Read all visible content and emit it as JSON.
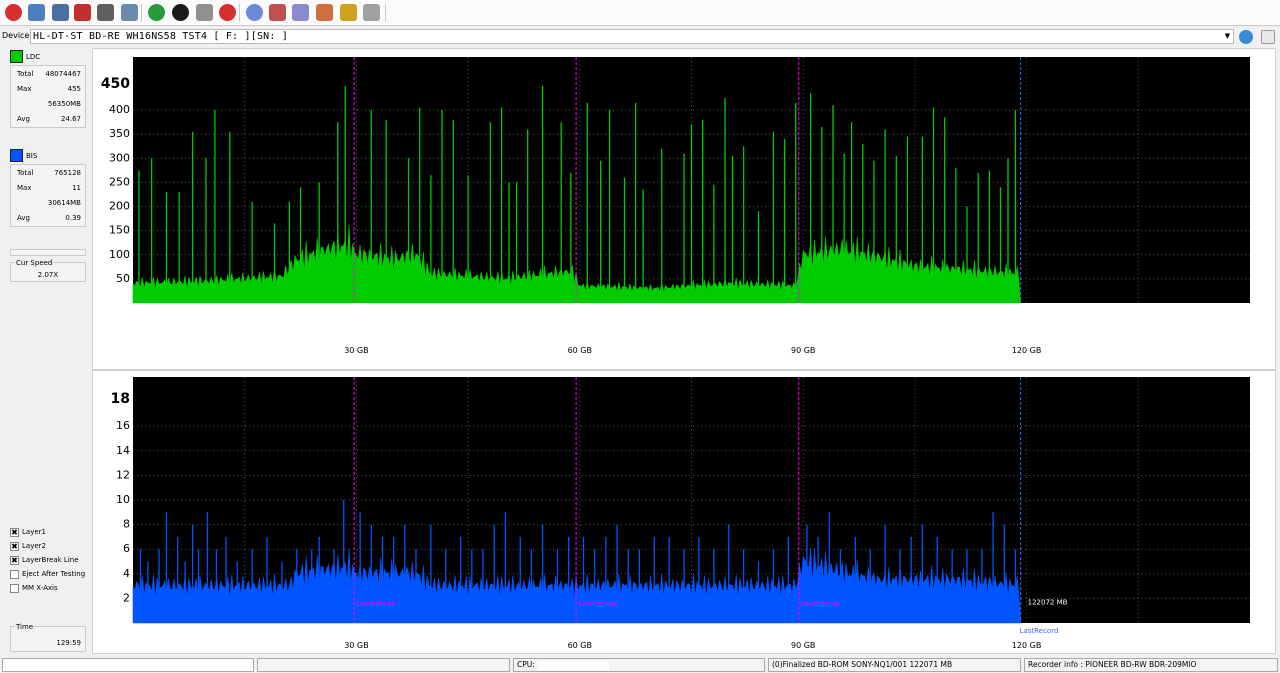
{
  "toolbar": {
    "icons": [
      "exit-icon",
      "settings-icon",
      "device-info-icon",
      "erase-icon",
      "disc-icon",
      "copy-icon",
      "refresh-icon",
      "start-icon",
      "quick-scan-icon",
      "stop-icon",
      "disc-quality-icon",
      "burn-icon",
      "save-icon",
      "screenshot-icon",
      "chart-icon",
      "clean-icon"
    ]
  },
  "device": {
    "label": "Device:",
    "value": "HL-DT-ST BD-RE  WH16NS58  TST4 [ F: ][SN:               ]"
  },
  "ldc": {
    "label": "LDC",
    "color": "#00cc00",
    "total_label": "Total",
    "total": "48074467",
    "max_label": "Max",
    "max": "455",
    "size": "56350MB",
    "avg_label": "Avg",
    "avg": "24.67"
  },
  "bis": {
    "label": "BIS",
    "color": "#0055ff",
    "total_label": "Total",
    "total": "765128",
    "max_label": "Max",
    "max": "11",
    "size": "30614MB",
    "avg_label": "Avg",
    "avg": "0.39"
  },
  "speed": {
    "label": "Cur Speed",
    "value": "2.07X"
  },
  "options": [
    {
      "label": "Layer1",
      "checked": true
    },
    {
      "label": "Layer2",
      "checked": true
    },
    {
      "label": "LayerBreak Line",
      "checked": true
    },
    {
      "label": "Eject After Testing",
      "checked": false
    },
    {
      "label": "MM X-Axis",
      "checked": false
    }
  ],
  "time": {
    "label": "Time",
    "value": "129:59"
  },
  "chart_data": [
    {
      "type": "area",
      "series": [
        {
          "name": "LDC",
          "color": "#00cc00"
        }
      ],
      "x_unit": "GB",
      "xlim": [
        0,
        150
      ],
      "ylim": [
        0,
        510
      ],
      "ymax_label": "450",
      "yticks": [
        50,
        100,
        150,
        200,
        250,
        300,
        350,
        400
      ],
      "xticks": [
        "30 GB",
        "60 GB",
        "90 GB",
        "120 GB"
      ],
      "xtick_values": [
        30,
        60,
        90,
        120
      ],
      "layer_breaks": [
        29.7,
        59.5,
        89.4
      ],
      "last_record": 119.2,
      "baseline_profile": [
        [
          0,
          40
        ],
        [
          10,
          45
        ],
        [
          20,
          55
        ],
        [
          22,
          90
        ],
        [
          26,
          110
        ],
        [
          29,
          120
        ],
        [
          30,
          100
        ],
        [
          35,
          90
        ],
        [
          38,
          100
        ],
        [
          40,
          60
        ],
        [
          50,
          50
        ],
        [
          59,
          65
        ],
        [
          60,
          35
        ],
        [
          70,
          30
        ],
        [
          80,
          40
        ],
        [
          89,
          35
        ],
        [
          90,
          100
        ],
        [
          95,
          110
        ],
        [
          100,
          95
        ],
        [
          105,
          75
        ],
        [
          110,
          70
        ],
        [
          119,
          60
        ]
      ],
      "spikes": [
        [
          0.8,
          275
        ],
        [
          2.5,
          300
        ],
        [
          4.5,
          230
        ],
        [
          6.2,
          230
        ],
        [
          8,
          355
        ],
        [
          9.8,
          300
        ],
        [
          11,
          400
        ],
        [
          13,
          355
        ],
        [
          16,
          210
        ],
        [
          19,
          165
        ],
        [
          21,
          210
        ],
        [
          22.5,
          240
        ],
        [
          25,
          250
        ],
        [
          27.5,
          375
        ],
        [
          28.5,
          450
        ],
        [
          32,
          400
        ],
        [
          34,
          380
        ],
        [
          37,
          300
        ],
        [
          38.5,
          405
        ],
        [
          40,
          265
        ],
        [
          41.5,
          400
        ],
        [
          43,
          380
        ],
        [
          45,
          265
        ],
        [
          48,
          375
        ],
        [
          49.5,
          405
        ],
        [
          50.5,
          250
        ],
        [
          51.5,
          250
        ],
        [
          53,
          360
        ],
        [
          55,
          450
        ],
        [
          57.5,
          375
        ],
        [
          58.8,
          270
        ],
        [
          61,
          415
        ],
        [
          62.8,
          295
        ],
        [
          64,
          400
        ],
        [
          66,
          260
        ],
        [
          67.5,
          415
        ],
        [
          68.5,
          235
        ],
        [
          71,
          320
        ],
        [
          74,
          310
        ],
        [
          75,
          370
        ],
        [
          76.5,
          380
        ],
        [
          78,
          245
        ],
        [
          79.5,
          425
        ],
        [
          80.5,
          305
        ],
        [
          82,
          325
        ],
        [
          84,
          190
        ],
        [
          86,
          355
        ],
        [
          87.5,
          340
        ],
        [
          89,
          415
        ],
        [
          91,
          435
        ],
        [
          92.5,
          365
        ],
        [
          94,
          410
        ],
        [
          95.5,
          310
        ],
        [
          96.5,
          375
        ],
        [
          98,
          330
        ],
        [
          99.5,
          295
        ],
        [
          101,
          360
        ],
        [
          102.5,
          305
        ],
        [
          104,
          345
        ],
        [
          106,
          345
        ],
        [
          107.5,
          405
        ],
        [
          109,
          385
        ],
        [
          110.5,
          280
        ],
        [
          112,
          200
        ],
        [
          113.5,
          270
        ],
        [
          115,
          275
        ],
        [
          116.5,
          240
        ],
        [
          117.5,
          300
        ],
        [
          118.5,
          400
        ]
      ]
    },
    {
      "type": "bar",
      "series": [
        {
          "name": "BIS",
          "color": "#0055ff"
        }
      ],
      "x_unit": "GB",
      "xlim": [
        0,
        150
      ],
      "ylim": [
        0,
        20
      ],
      "ymax_label": "18",
      "yticks": [
        2,
        4,
        6,
        8,
        10,
        12,
        14,
        16
      ],
      "xticks": [
        "30 GB",
        "60 GB",
        "90 GB",
        "120 GB"
      ],
      "xtick_values": [
        30,
        60,
        90,
        120
      ],
      "layer_breaks": [
        29.7,
        59.5,
        89.4
      ],
      "layer_break_label": "LayerBreak",
      "last_record": 119.2,
      "last_record_label": "LastRecord",
      "last_record_value": "122072 MB",
      "baseline_profile": [
        [
          0,
          3
        ],
        [
          21,
          3
        ],
        [
          22,
          4
        ],
        [
          29,
          4.5
        ],
        [
          30,
          4
        ],
        [
          38,
          4
        ],
        [
          40,
          3
        ],
        [
          60,
          3
        ],
        [
          89,
          3
        ],
        [
          90,
          5
        ],
        [
          96,
          4
        ],
        [
          100,
          3.5
        ],
        [
          110,
          3.5
        ],
        [
          119,
          3
        ]
      ],
      "spikes": [
        [
          1,
          6
        ],
        [
          2,
          5
        ],
        [
          3.5,
          6
        ],
        [
          4.5,
          9
        ],
        [
          6,
          7
        ],
        [
          7,
          5
        ],
        [
          8,
          8
        ],
        [
          8.8,
          6
        ],
        [
          10,
          9
        ],
        [
          11.2,
          6
        ],
        [
          12.5,
          7
        ],
        [
          14,
          5
        ],
        [
          16,
          6
        ],
        [
          18,
          7
        ],
        [
          20,
          5
        ],
        [
          22,
          6
        ],
        [
          24,
          6
        ],
        [
          25,
          7
        ],
        [
          27,
          6
        ],
        [
          28.3,
          10
        ],
        [
          30.5,
          9
        ],
        [
          32,
          8
        ],
        [
          33.5,
          7
        ],
        [
          35,
          7
        ],
        [
          36.5,
          8
        ],
        [
          38,
          6
        ],
        [
          40,
          8
        ],
        [
          42,
          6
        ],
        [
          44,
          7
        ],
        [
          45.5,
          6
        ],
        [
          47,
          6
        ],
        [
          48.5,
          8
        ],
        [
          50,
          9
        ],
        [
          52,
          7
        ],
        [
          53.5,
          6
        ],
        [
          55,
          8
        ],
        [
          57,
          6
        ],
        [
          58.5,
          7
        ],
        [
          60.5,
          7
        ],
        [
          62,
          6
        ],
        [
          63.5,
          7
        ],
        [
          65,
          8
        ],
        [
          66.5,
          6
        ],
        [
          68,
          6
        ],
        [
          70,
          7
        ],
        [
          72,
          7
        ],
        [
          74,
          6
        ],
        [
          76,
          7
        ],
        [
          78,
          6
        ],
        [
          80,
          8
        ],
        [
          82,
          6
        ],
        [
          84,
          5
        ],
        [
          86,
          6
        ],
        [
          88,
          7
        ],
        [
          90.5,
          8
        ],
        [
          92,
          7
        ],
        [
          93.5,
          9
        ],
        [
          95,
          6
        ],
        [
          97,
          7
        ],
        [
          99,
          6
        ],
        [
          101,
          8
        ],
        [
          103,
          6
        ],
        [
          104.5,
          7
        ],
        [
          106,
          8
        ],
        [
          108,
          7
        ],
        [
          110,
          6
        ],
        [
          112,
          6
        ],
        [
          114,
          6
        ],
        [
          115.5,
          9
        ],
        [
          117,
          8
        ],
        [
          118.5,
          6
        ]
      ]
    }
  ],
  "status": {
    "cpu_label": "CPU:",
    "disc": "(0)Finalized  BD-ROM  SONY-NQ1/001  122071 MB",
    "recorder": "Recorder info : PIONEER       BD-RW BDR-209MIO"
  }
}
